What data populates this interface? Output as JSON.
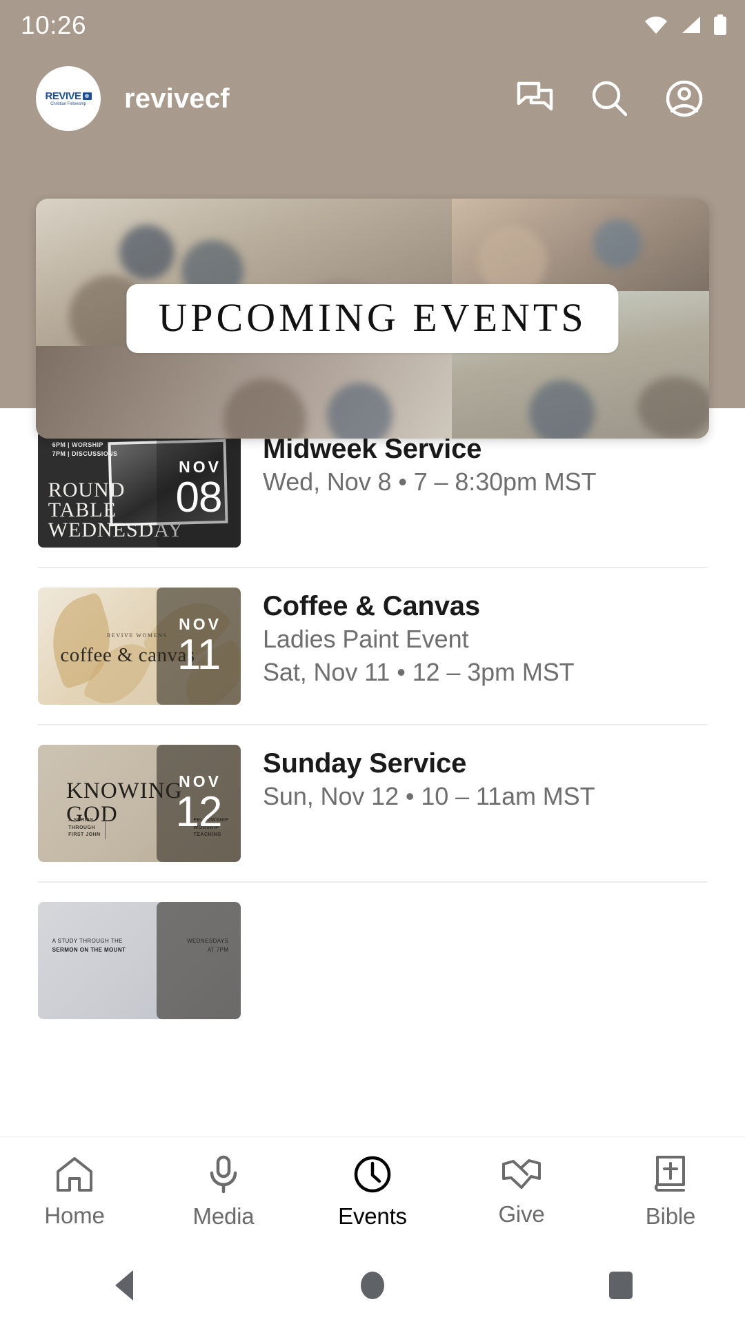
{
  "statusbar": {
    "time": "10:26",
    "icons": [
      "wifi-icon",
      "cellular-signal-icon",
      "battery-icon"
    ]
  },
  "appbar": {
    "avatar": {
      "icon": "revive-logo-icon",
      "brand": "REVIVE",
      "tagline": "Christian Fellowship",
      "mark": "❁"
    },
    "title": "revivecf",
    "actions": [
      {
        "name": "chat-icon",
        "label": "Chat"
      },
      {
        "name": "search-icon",
        "label": "Search"
      },
      {
        "name": "account-icon",
        "label": "Account"
      }
    ]
  },
  "hero": {
    "banner_text": "UPCOMING EVENTS",
    "name": "upcoming-events-banner"
  },
  "events": [
    {
      "title": "Midweek Service",
      "subtitle": "",
      "datetime": "Wed, Nov 8 • 7 – 8:30pm MST",
      "badge_month": "NOV",
      "badge_day": "08",
      "thumb": {
        "top_lines": "6PM | WORSHIP\n7PM | DISCUSSIONS",
        "headline": "ROUND\nTABLE\nWEDNESDAY"
      }
    },
    {
      "title": "Coffee & Canvas",
      "subtitle": "Ladies Paint Event",
      "datetime": "Sat, Nov 11 • 12 – 3pm MST",
      "badge_month": "NOV",
      "badge_day": "11",
      "thumb": {
        "eyebrow": "REVIVE WOMENS",
        "headline": "coffee & canvas"
      }
    },
    {
      "title": "Sunday Service",
      "subtitle": "",
      "datetime": "Sun, Nov 12 • 10 – 11am MST",
      "badge_month": "NOV",
      "badge_day": "12",
      "thumb": {
        "headline": "KNOWING\nGOD",
        "left_note": "A SERIES\nTHROUGH\nFIRST JOHN",
        "right_note": "FELLOWSHIP\nWORSHIP\nTEACHING"
      }
    },
    {
      "title": "",
      "subtitle": "",
      "datetime": "",
      "badge_month": "",
      "badge_day": "",
      "thumb": {
        "left_note_small": "A STUDY THROUGH THE",
        "left_note_bold": "SERMON ON THE MOUNT",
        "right_note": "WEDNESDAYS\nAT 7PM"
      }
    }
  ],
  "tabs": [
    {
      "label": "Home",
      "icon": "home-icon",
      "active": false
    },
    {
      "label": "Media",
      "icon": "microphone-icon",
      "active": false
    },
    {
      "label": "Events",
      "icon": "clock-icon",
      "active": true
    },
    {
      "label": "Give",
      "icon": "giving-hands-icon",
      "active": false
    },
    {
      "label": "Bible",
      "icon": "bible-book-icon",
      "active": false
    }
  ],
  "androidnav": [
    {
      "name": "android-back-button"
    },
    {
      "name": "android-home-button"
    },
    {
      "name": "android-recents-button"
    }
  ],
  "colors": {
    "header_bg": "#a89a8c",
    "accent_text": "#ffffff",
    "title_text": "#1a1a1a",
    "subtitle_text": "#6e6e6e",
    "divider": "#ececec",
    "tab_inactive": "#6b6b6b",
    "tab_active": "#000000"
  }
}
